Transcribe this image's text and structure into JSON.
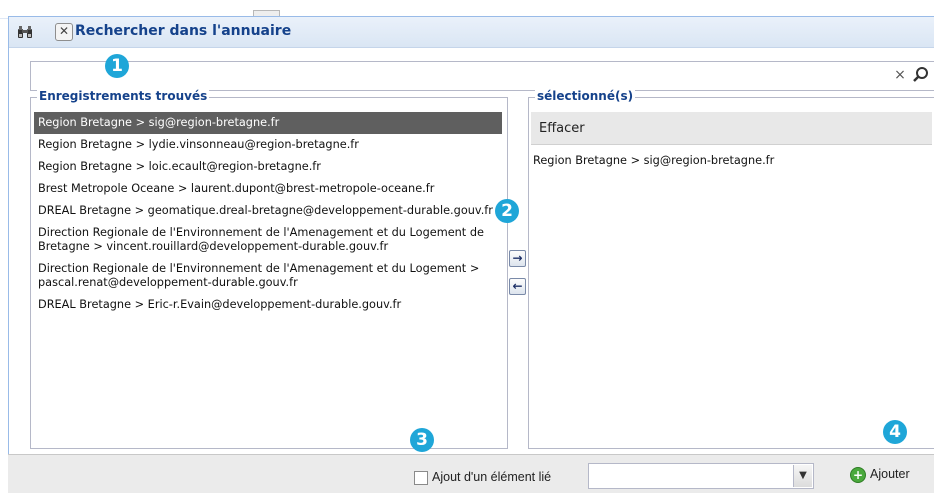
{
  "window": {
    "title": "Rechercher dans l'annuaire",
    "close_glyph": "✕"
  },
  "search": {
    "value": "",
    "clear_glyph": "×",
    "search_icon": "magnifier-icon"
  },
  "found_panel": {
    "legend": "Enregistrements trouvés",
    "items": [
      {
        "text": "Region Bretagne > sig@region-bretagne.fr",
        "selected": true
      },
      {
        "text": "Region Bretagne > lydie.vinsonneau@region-bretagne.fr",
        "selected": false
      },
      {
        "text": "Region Bretagne > loic.ecault@region-bretagne.fr",
        "selected": false
      },
      {
        "text": "Brest Metropole Oceane > laurent.dupont@brest-metropole-oceane.fr",
        "selected": false
      },
      {
        "text": "DREAL Bretagne > geomatique.dreal-bretagne@developpement-durable.gouv.fr",
        "selected": false
      },
      {
        "text": "Direction Regionale de l'Environnement de l'Amenagement et du Logement de Bretagne > vincent.rouillard@developpement-durable.gouv.fr",
        "selected": false
      },
      {
        "text": "Direction Regionale de l'Environnement de l'Amenagement et du Logement > pascal.renat@developpement-durable.gouv.fr",
        "selected": false
      },
      {
        "text": "DREAL Bretagne > Eric-r.Evain@developpement-durable.gouv.fr",
        "selected": false
      }
    ]
  },
  "selected_panel": {
    "legend": "sélectionné(s)",
    "clear_label": "Effacer",
    "items": [
      "Region Bretagne > sig@region-bretagne.fr"
    ]
  },
  "arrows": {
    "add_glyph": "→",
    "remove_glyph": "←"
  },
  "footer": {
    "link_label": "Ajout d'un élément lié",
    "link_checked": false,
    "combo_value": "",
    "combo_arrow": "▼",
    "add_label": "Ajouter",
    "add_glyph": "+"
  },
  "badges": [
    "1",
    "2",
    "3",
    "4"
  ],
  "colors": {
    "title_blue": "#15428b",
    "badge_blue": "#1fa6d8",
    "selected_row": "#5f5f5f",
    "add_green": "#4aa93c"
  }
}
